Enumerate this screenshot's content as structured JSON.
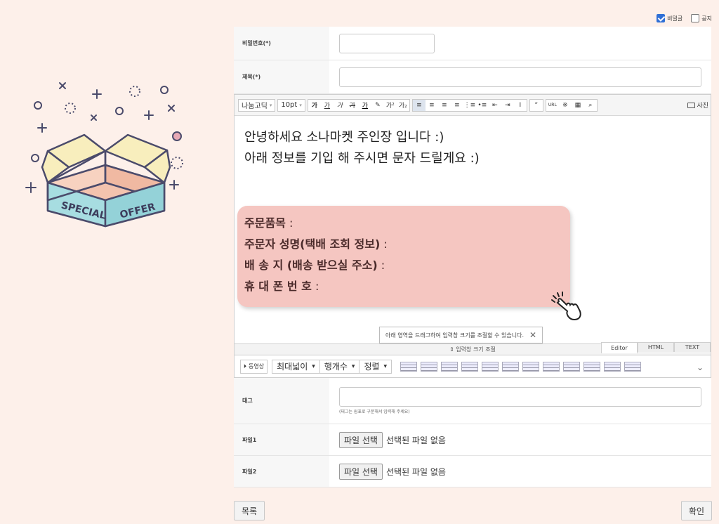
{
  "options": {
    "secret_label": "비밀글",
    "notice_label": "공지"
  },
  "form": {
    "password_label": "비밀번호(*)",
    "title_label": "제목(*)",
    "tag_label": "태그",
    "tag_hint": "(태그는 쉼표로 구분해서 입력해 주세요)",
    "file1_label": "파일1",
    "file2_label": "파일2",
    "file_button": "파일 선택",
    "file_none": "선택된 파일 없음"
  },
  "editor": {
    "font_select": "나눔고딕",
    "size_select": "10pt",
    "photo_label": "사진",
    "body_line1": "안녕하세요 소나마켓 주인장 입니다 :)",
    "body_line2": "아래 정보를 기입 해 주시면 문자 드릴게요 :)",
    "order_item": "주문품목",
    "orderer_name": "주문자 성명(택배 조회 정보)",
    "address": "배 송 지 (배송 받으실 주소)",
    "phone": "휴 대 폰 번 호",
    "colon": " :",
    "tooltip": "아래 영역을 드래그하여 입력창 크기를 조절할 수 있습니다.",
    "resize_label": "⇕ 입력창 크기 조절",
    "tabs": [
      "Editor",
      "HTML",
      "TEXT"
    ]
  },
  "video_toolbar": {
    "video_label": "동영상",
    "max_width": "최대넓이",
    "rows": "행개수",
    "align": "정렬"
  },
  "buttons": {
    "list": "목록",
    "confirm": "확인"
  },
  "promo": {
    "word1": "SPECIAL",
    "word2": "OFFER"
  },
  "colors": {
    "bg": "#fdf0ea",
    "card": "#f5c6c1",
    "accent": "#2f6fd6"
  }
}
